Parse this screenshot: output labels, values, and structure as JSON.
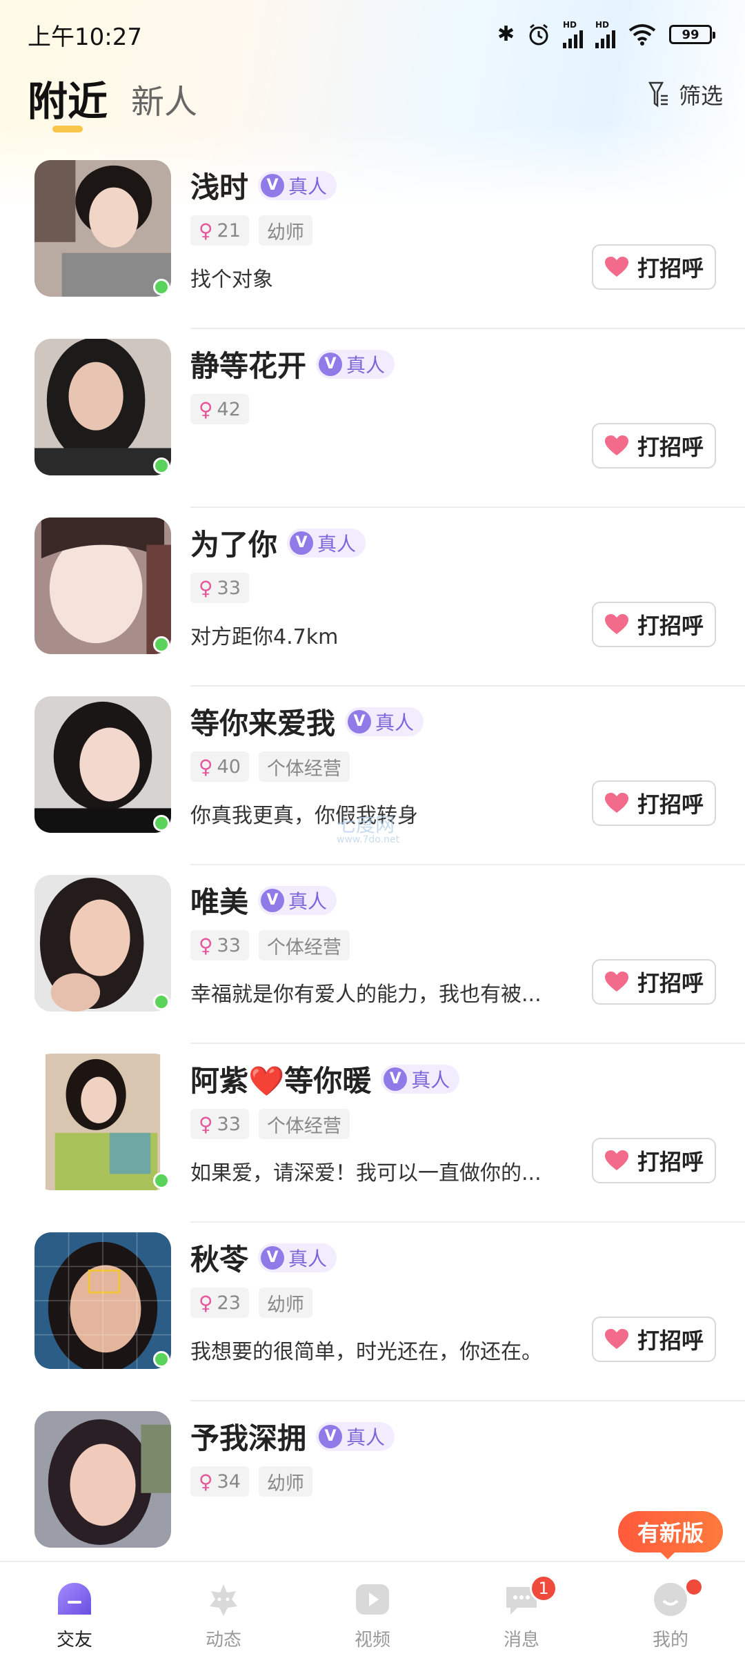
{
  "status_bar": {
    "time": "上午10:27",
    "battery": "99",
    "icons": [
      "bluetooth-icon",
      "alarm-icon",
      "hd-signal-icon",
      "hd-signal-icon",
      "wifi-icon",
      "battery-icon"
    ]
  },
  "header": {
    "tabs": [
      {
        "label": "附近",
        "active": true
      },
      {
        "label": "新人",
        "active": false
      }
    ],
    "filter_label": "筛选"
  },
  "colors": {
    "accent_indicator": "#f7c64a",
    "verified": "#8f7be8",
    "female": "#e4579b",
    "online": "#5ad35a",
    "badge": "#f04a3c"
  },
  "users": [
    {
      "name": "浅时",
      "verified_label": "真人",
      "age": "21",
      "occupation": "幼师",
      "bio": "找个对象",
      "button": "打招呼"
    },
    {
      "name": "静等花开",
      "verified_label": "真人",
      "age": "42",
      "occupation": "",
      "bio": "",
      "button": "打招呼"
    },
    {
      "name": "为了你",
      "verified_label": "真人",
      "age": "33",
      "occupation": "",
      "bio": "对方距你4.7km",
      "button": "打招呼"
    },
    {
      "name": "等你来爱我",
      "verified_label": "真人",
      "age": "40",
      "occupation": "个体经营",
      "bio": "你真我更真，你假我转身",
      "button": "打招呼"
    },
    {
      "name": "唯美",
      "verified_label": "真人",
      "age": "33",
      "occupation": "个体经营",
      "bio": "幸福就是你有爱人的能力，我也有被...",
      "button": "打招呼"
    },
    {
      "name": "阿紫❤️等你暖",
      "verified_label": "真人",
      "age": "33",
      "occupation": "个体经营",
      "bio": "如果爱，请深爱！我可以一直做你的...",
      "button": "打招呼"
    },
    {
      "name": "秋苓",
      "verified_label": "真人",
      "age": "23",
      "occupation": "幼师",
      "bio": "我想要的很简单，时光还在，你还在。",
      "button": "打招呼"
    },
    {
      "name": "予我深拥",
      "verified_label": "真人",
      "age": "34",
      "occupation": "幼师",
      "bio": "",
      "button": ""
    }
  ],
  "watermark": {
    "line1": "七度网",
    "line2": "www.7do.net"
  },
  "new_version": "有新版",
  "bottom_nav": [
    {
      "label": "交友",
      "icon": "friends-icon",
      "active": true
    },
    {
      "label": "动态",
      "icon": "moments-icon",
      "active": false
    },
    {
      "label": "视频",
      "icon": "video-icon",
      "active": false
    },
    {
      "label": "消息",
      "icon": "message-icon",
      "active": false,
      "badge": "1"
    },
    {
      "label": "我的",
      "icon": "profile-icon",
      "active": false
    }
  ]
}
